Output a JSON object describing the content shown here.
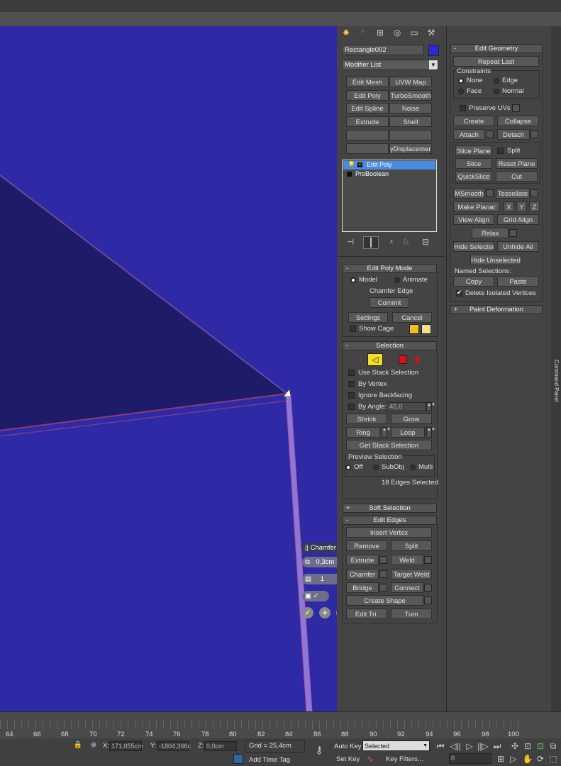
{
  "object_name": "Rectangle002",
  "object_color": "#2a2ad0",
  "modifier_list": "Modifier List",
  "modifier_buttons": [
    "Edit Mesh",
    "UVW Map",
    "Edit Poly",
    "TurboSmooth",
    "Edit Spline",
    "Noise",
    "Extrude",
    "Shell",
    "",
    "",
    "",
    "yDisplacement"
  ],
  "stack": [
    "Edit Poly",
    "ProBoolean"
  ],
  "edit_poly_mode": {
    "title": "Edit Poly Mode",
    "model": "Model",
    "animate": "Animate",
    "current_op": "Chamfer Edge",
    "commit": "Commit",
    "settings": "Settings",
    "cancel": "Cancel",
    "show_cage": "Show Cage"
  },
  "selection": {
    "title": "Selection",
    "use_stack": "Use Stack Selection",
    "by_vertex": "By Vertex",
    "ignore_backfacing": "Ignore Backfacing",
    "by_angle": "By Angle:",
    "angle_value": "45,0",
    "shrink": "Shrink",
    "grow": "Grow",
    "ring": "Ring",
    "loop": "Loop",
    "get_stack": "Get Stack Selection",
    "preview_title": "Preview Selection",
    "off": "Off",
    "subobj": "SubObj",
    "multi": "Multi",
    "status": "18 Edges Selected"
  },
  "soft_selection": "Soft Selection",
  "edit_edges": {
    "title": "Edit Edges",
    "insert_vertex": "Insert Vertex",
    "remove": "Remove",
    "split": "Split",
    "extrude": "Extrude",
    "weld": "Weld",
    "chamfer": "Chamfer",
    "target_weld": "Target Weld",
    "bridge": "Bridge",
    "connect": "Connect",
    "create_shape": "Create Shape",
    "edit_tri": "Edit Tri.",
    "turn": "Turn"
  },
  "caddy": {
    "title": "Chamfer",
    "amount": "0,3cm",
    "segments": "1"
  },
  "edit_geometry": {
    "title": "Edit Geometry",
    "repeat_last": "Repeat Last",
    "constraints": "Constraints",
    "none": "None",
    "edge": "Edge",
    "face": "Face",
    "normal": "Normal",
    "preserve_uvs": "Preserve UVs",
    "create": "Create",
    "collapse": "Collapse",
    "attach": "Attach",
    "detach": "Detach",
    "slice_plane": "Slice Plane",
    "split": "Split",
    "slice": "Slice",
    "reset_plane": "Reset Plane",
    "quickslice": "QuickSlice",
    "cut": "Cut",
    "msmooth": "MSmooth",
    "tessellate": "Tessellate",
    "make_planar": "Make Planar",
    "x": "X",
    "y": "Y",
    "z": "Z",
    "view_align": "View Align",
    "grid_align": "Grid Align",
    "relax": "Relax",
    "hide_selected": "Hide Selected",
    "unhide_all": "Unhide All",
    "hide_unselected": "Hide Unselected",
    "named_selections": "Named Selections:",
    "copy": "Copy",
    "paste": "Paste",
    "delete_isolated": "Delete Isolated Vertices"
  },
  "paint_deformation": "Paint Deformation",
  "command_panel": "Command Panel",
  "timeline_ticks": [
    "64",
    "66",
    "68",
    "70",
    "72",
    "74",
    "76",
    "78",
    "80",
    "82",
    "84",
    "86",
    "88",
    "90",
    "92",
    "94",
    "96",
    "98",
    "100"
  ],
  "status": {
    "x_label": "X:",
    "x_value": "171,055cm",
    "y_label": "Y:",
    "y_value": "-1804,366c",
    "z_label": "Z:",
    "z_value": "0,0cm",
    "grid": "Grid = 25,4cm",
    "auto_key": "Auto Key",
    "selected": "Selected",
    "set_key": "Set Key",
    "key_filters": "Key Filters...",
    "add_time_tag": "Add Time Tag",
    "frame": "0"
  }
}
